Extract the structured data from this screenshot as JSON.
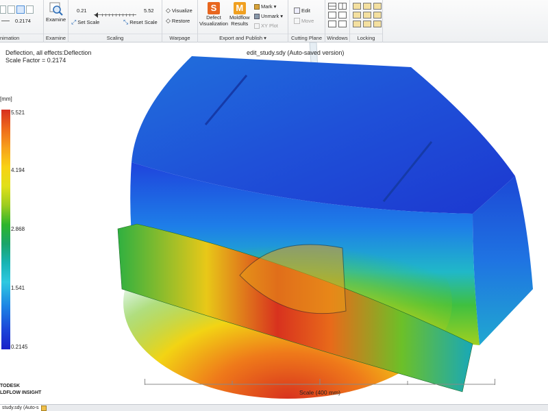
{
  "ribbon": {
    "animation": {
      "value": "0.2174",
      "label": "nimation"
    },
    "examine": {
      "button": "Examine",
      "label": "Examine"
    },
    "scaling": {
      "min": "0.21",
      "max": "5.52",
      "set_scale": "Set Scale",
      "reset_scale": "Reset Scale",
      "label": "Scaling"
    },
    "warpage": {
      "visualize": "Visualize",
      "restore": "Restore",
      "label": "Warpage"
    },
    "export": {
      "defect_line1": "Defect",
      "defect_line2": "Visualization",
      "moldflow_line1": "Moldflow",
      "moldflow_line2": "Results",
      "mark": "Mark",
      "unmark": "Unmark",
      "xy_plot": "XY Plot",
      "label": "Export and Publish"
    },
    "cutting": {
      "edit": "Edit",
      "move": "Move",
      "label": "Cutting Plane"
    },
    "windows": {
      "label": "Windows"
    },
    "locking": {
      "label": "Locking"
    }
  },
  "viewport": {
    "result_line1": "Deflection, all effects:Deflection",
    "result_line2": "Scale Factor = 0.2174",
    "study_title": "edit_study.sdy (Auto-saved version)"
  },
  "legend": {
    "unit": "[mm]",
    "ticks": [
      "5.521",
      "4.194",
      "2.868",
      "1.541",
      "0.2145"
    ]
  },
  "scale": {
    "label": "Scale (400 mm)"
  },
  "branding": {
    "line1": "TODESK",
    "line2": "LDFLOW INSIGHT"
  },
  "tab": {
    "label": "study.sdy (Auto-s"
  },
  "colors": {
    "accent": "#2b6fd8",
    "defect_icon": "#e8661f",
    "moldflow_icon": "#f0a020"
  }
}
